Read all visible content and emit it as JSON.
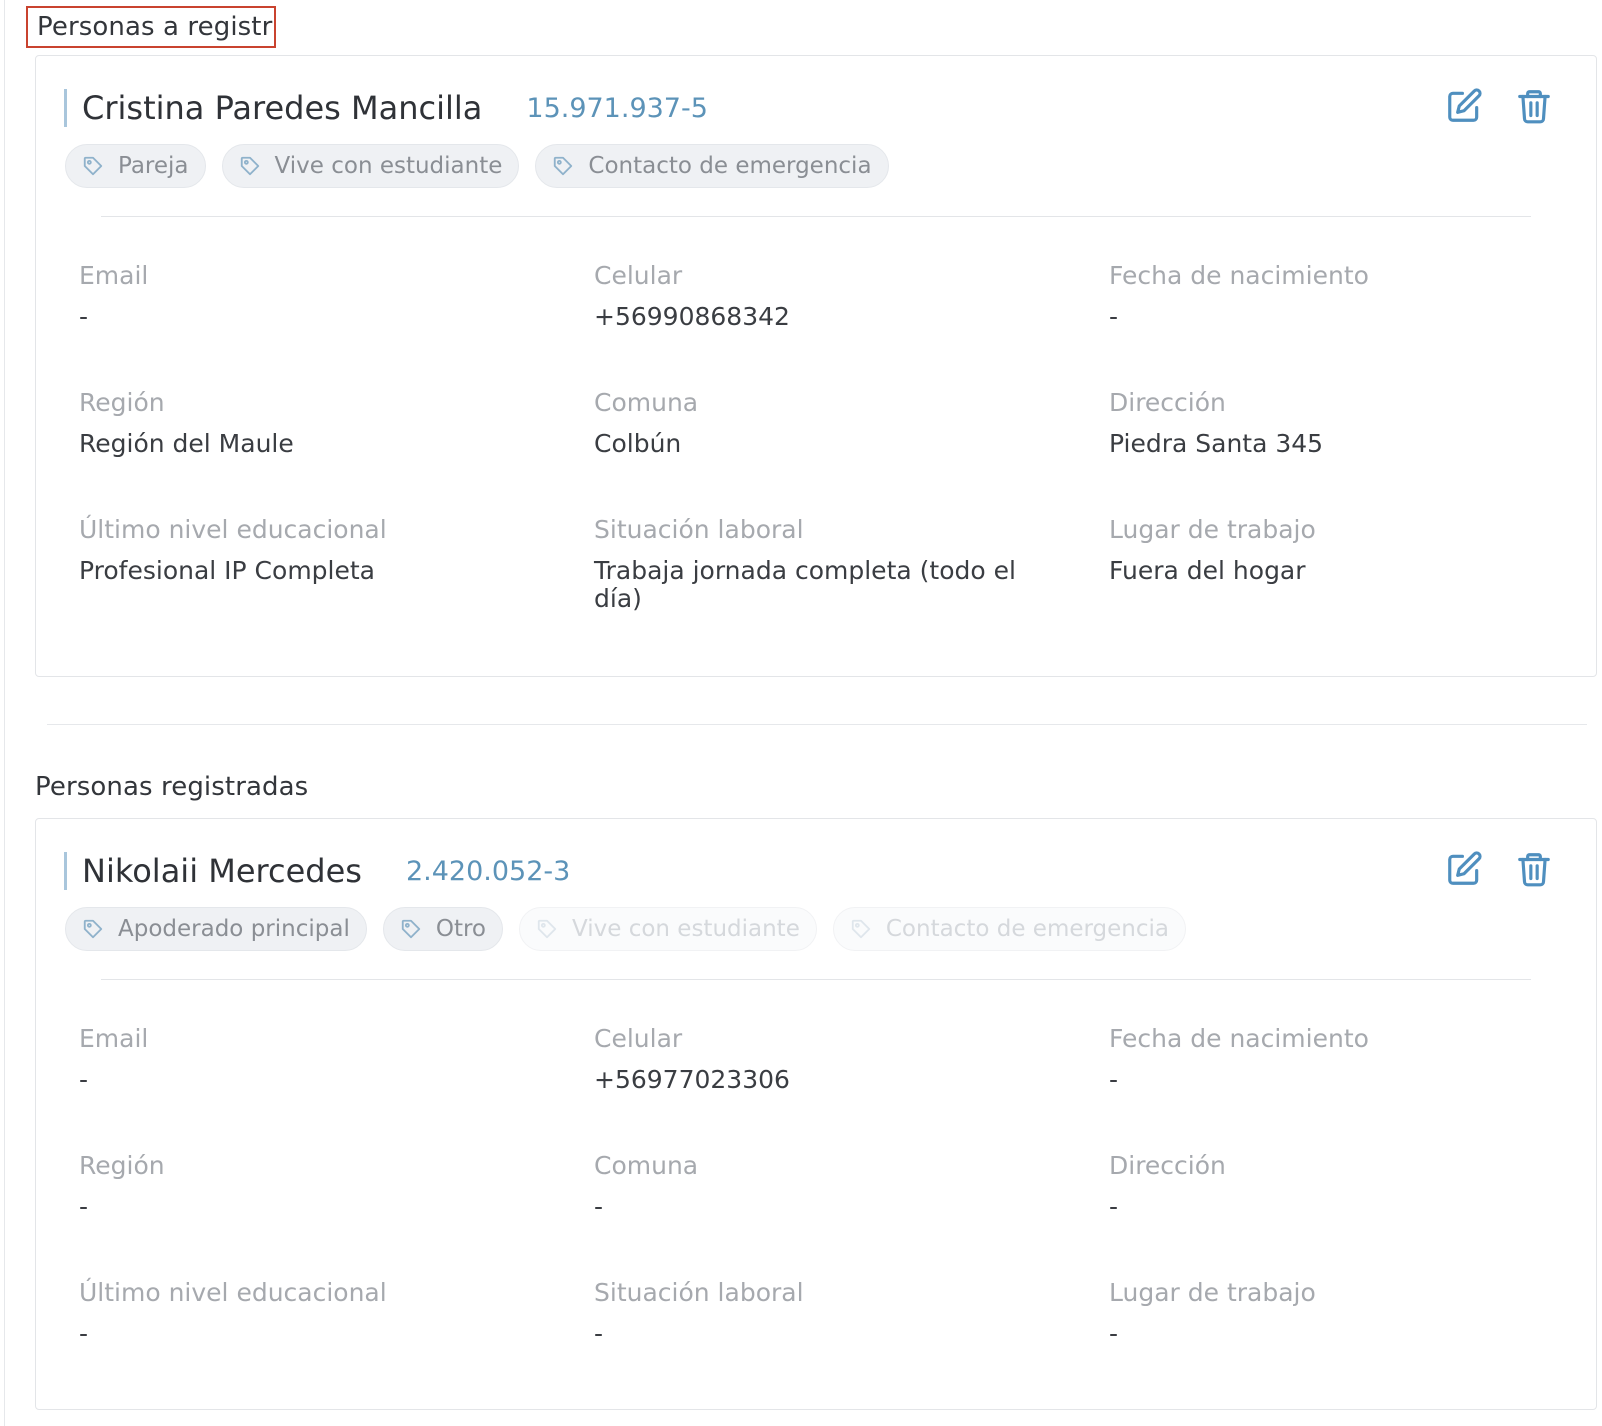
{
  "sections": {
    "to_register": {
      "title": "Personas a registrar"
    },
    "registered": {
      "title": "Personas registradas"
    }
  },
  "cards": [
    {
      "name": "Cristina Paredes Mancilla",
      "rut": "15.971.937-5",
      "tags": [
        {
          "label": "Pareja",
          "active": true
        },
        {
          "label": "Vive con estudiante",
          "active": true
        },
        {
          "label": "Contacto de emergencia",
          "active": true
        }
      ],
      "fields": {
        "email": {
          "label": "Email",
          "value": "-"
        },
        "celular": {
          "label": "Celular",
          "value": "+56990868342"
        },
        "fecha_nacimiento": {
          "label": "Fecha de nacimiento",
          "value": "-"
        },
        "region": {
          "label": "Región",
          "value": "Región del Maule"
        },
        "comuna": {
          "label": "Comuna",
          "value": "Colbún"
        },
        "direccion": {
          "label": "Dirección",
          "value": "Piedra Santa 345"
        },
        "nivel_educacional": {
          "label": "Último nivel educacional",
          "value": "Profesional IP Completa"
        },
        "situacion_laboral": {
          "label": "Situación laboral",
          "value": "Trabaja jornada completa (todo el día)"
        },
        "lugar_trabajo": {
          "label": "Lugar de trabajo",
          "value": "Fuera del hogar"
        }
      }
    },
    {
      "name": "Nikolaii Mercedes",
      "rut": "2.420.052-3",
      "tags": [
        {
          "label": "Apoderado principal",
          "active": true
        },
        {
          "label": "Otro",
          "active": true
        },
        {
          "label": "Vive con estudiante",
          "active": false
        },
        {
          "label": "Contacto de emergencia",
          "active": false
        }
      ],
      "fields": {
        "email": {
          "label": "Email",
          "value": "-"
        },
        "celular": {
          "label": "Celular",
          "value": "+56977023306"
        },
        "fecha_nacimiento": {
          "label": "Fecha de nacimiento",
          "value": "-"
        },
        "region": {
          "label": "Región",
          "value": "-"
        },
        "comuna": {
          "label": "Comuna",
          "value": "-"
        },
        "direccion": {
          "label": "Dirección",
          "value": "-"
        },
        "nivel_educacional": {
          "label": "Último nivel educacional",
          "value": "-"
        },
        "situacion_laboral": {
          "label": "Situación laboral",
          "value": "-"
        },
        "lugar_trabajo": {
          "label": "Lugar de trabajo",
          "value": "-"
        }
      }
    }
  ],
  "icons": {
    "edit": "edit-icon",
    "delete": "trash-icon",
    "tag": "tag-icon"
  },
  "colors": {
    "accent": "#4f8fbf",
    "rut": "#5c93b8",
    "highlight_border": "#c9432f"
  }
}
